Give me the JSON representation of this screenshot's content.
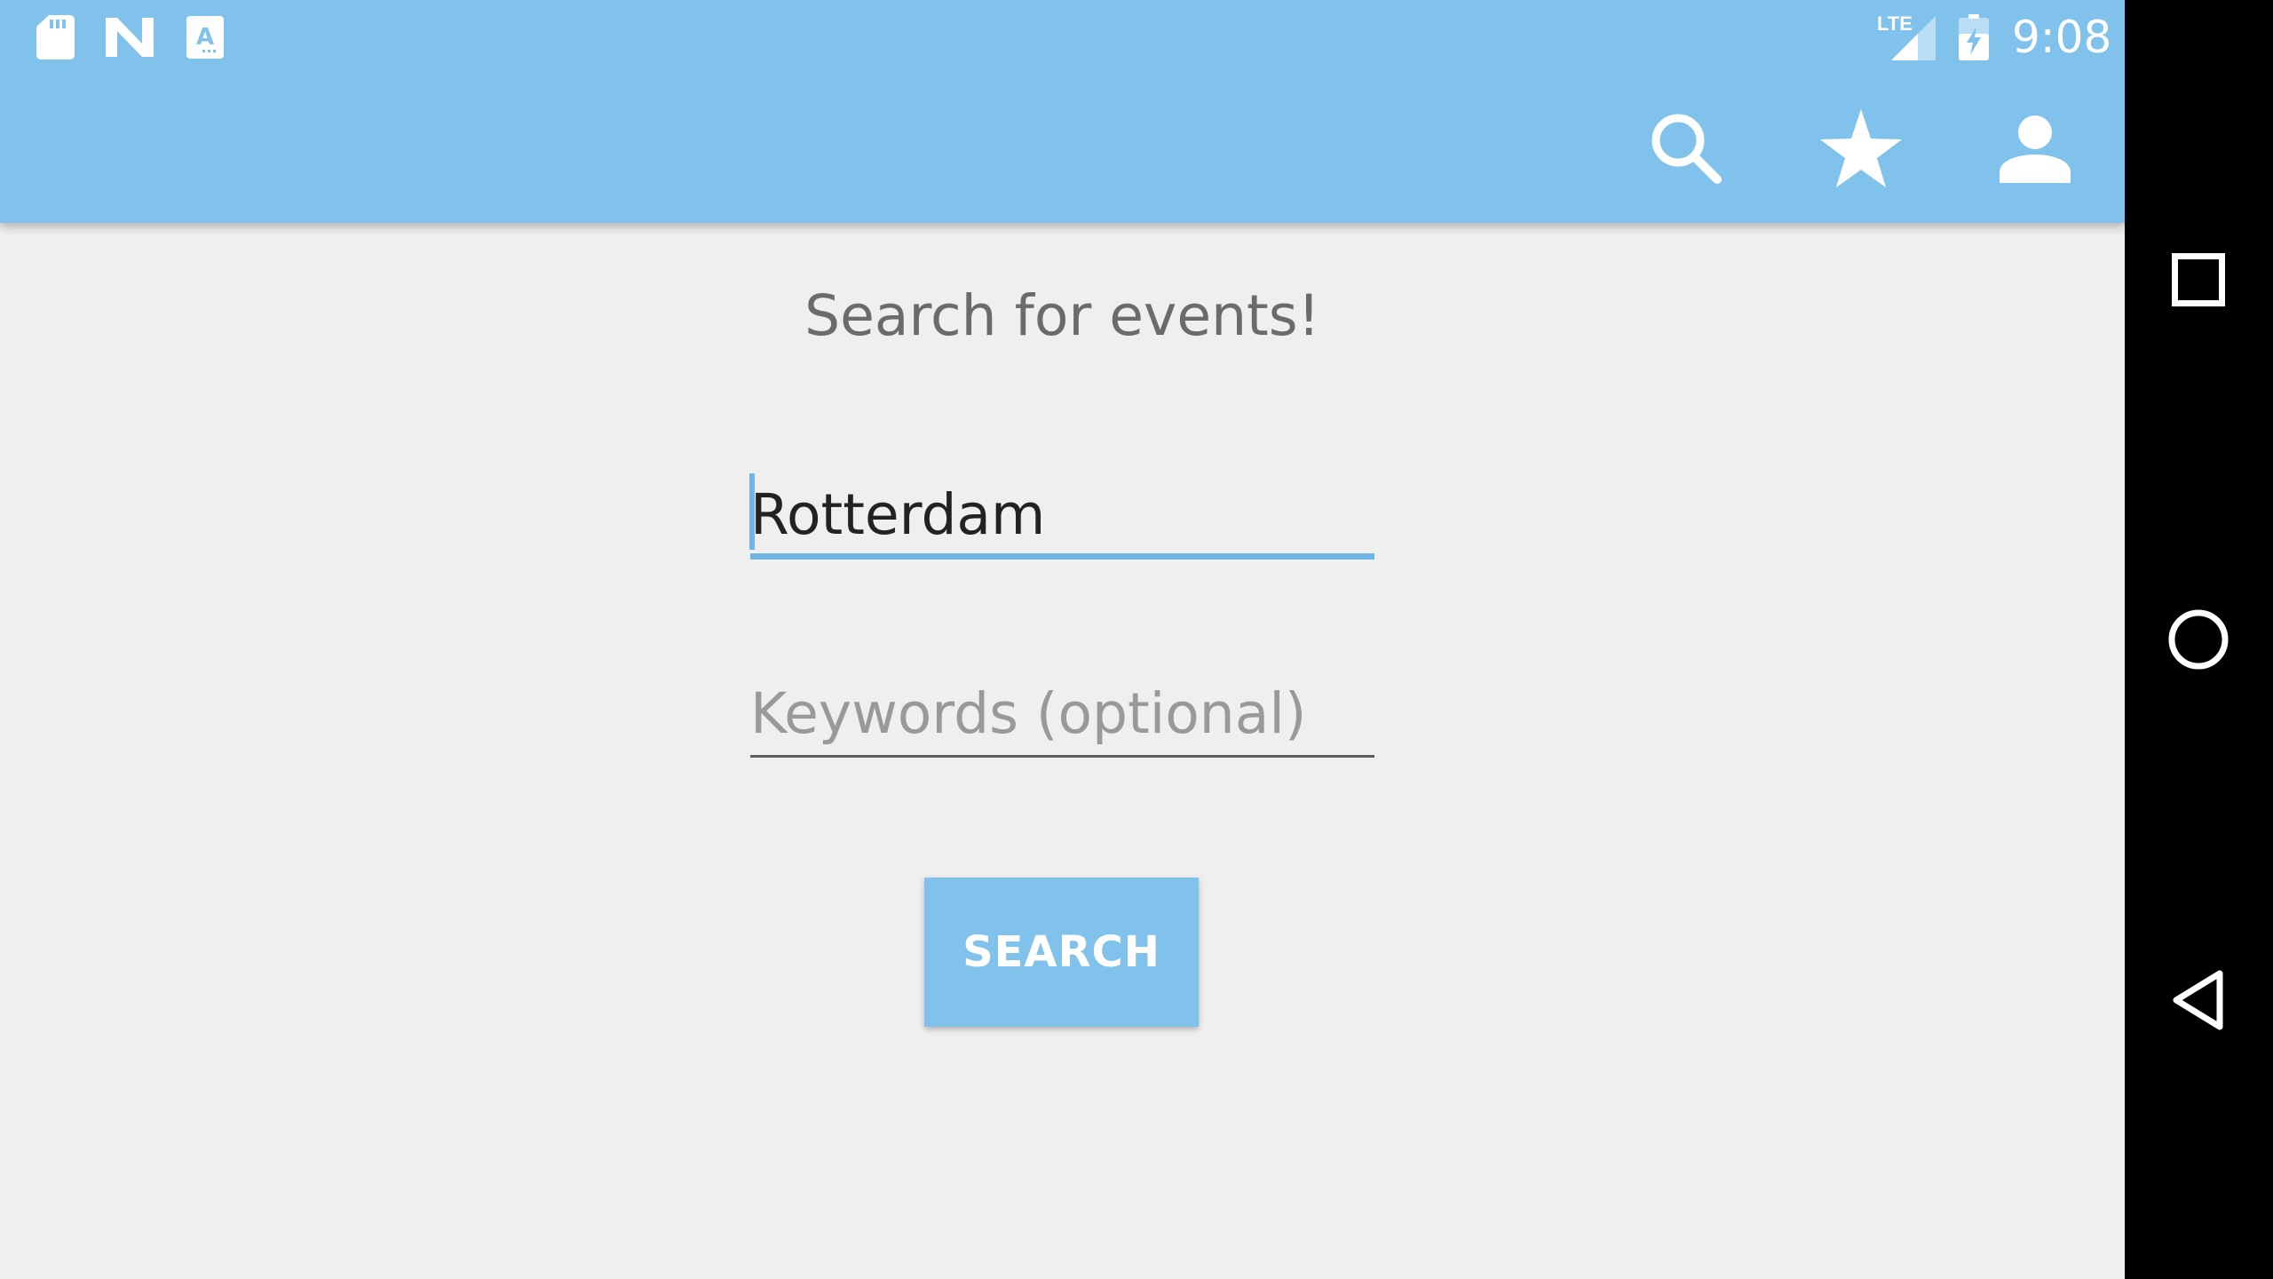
{
  "status_bar": {
    "time": "9:08",
    "network_label": "LTE",
    "notification_icons": [
      "sd-card-icon",
      "n-logo-icon",
      "keyboard-a-icon"
    ],
    "system_icons": [
      "lte-signal-icon",
      "battery-charging-icon"
    ]
  },
  "app_bar": {
    "background_color": "#80c2eb",
    "actions": [
      {
        "icon": "search-icon"
      },
      {
        "icon": "star-icon"
      },
      {
        "icon": "account-icon"
      }
    ]
  },
  "main": {
    "heading": "Search for events!",
    "location_input": {
      "value": "Rotterdam",
      "focused": true,
      "accent_color": "#6fb6e2"
    },
    "keywords_input": {
      "value": "",
      "placeholder": "Keywords (optional)"
    },
    "search_button": {
      "label": "SEARCH"
    }
  },
  "navigation_bar": {
    "buttons": [
      "recents-square-icon",
      "home-circle-icon",
      "back-triangle-icon"
    ]
  }
}
